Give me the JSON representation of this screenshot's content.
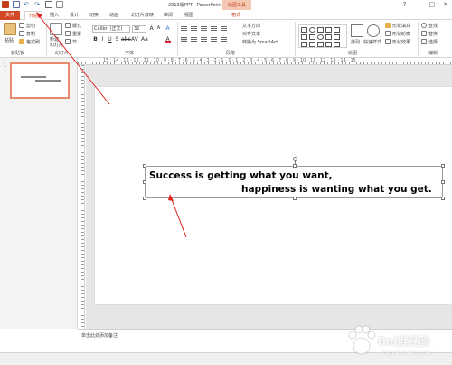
{
  "window": {
    "title": "2013版PPT - PowerPoint",
    "context_tab_group": "绘图工具",
    "controls": [
      "?",
      "—",
      "□",
      "✕"
    ]
  },
  "tabs": [
    {
      "label": "文件"
    },
    {
      "label": "开始"
    },
    {
      "label": "插入"
    },
    {
      "label": "设计"
    },
    {
      "label": "切换"
    },
    {
      "label": "动画"
    },
    {
      "label": "幻灯片放映"
    },
    {
      "label": "审阅"
    },
    {
      "label": "视图"
    },
    {
      "label": "格式"
    }
  ],
  "ribbon": {
    "clipboard": {
      "paste": "粘贴",
      "cut": "剪切",
      "copy": "复制",
      "format_painter": "格式刷",
      "group": "剪贴板"
    },
    "slides": {
      "new_slide": "新建\n幻灯片",
      "layout": "版式",
      "reset": "重置",
      "section": "节",
      "group": "幻灯片"
    },
    "font": {
      "font_name": "Calibri (正文)",
      "font_size": "32",
      "group": "字体"
    },
    "paragraph": {
      "text_direction": "文字方向",
      "align_text": "对齐文本",
      "smartart": "转换为 SmartArt",
      "group": "段落"
    },
    "drawing": {
      "arrange": "排列",
      "quick_styles": "快速样式",
      "shape_fill": "形状填充",
      "shape_outline": "形状轮廓",
      "shape_effects": "形状效果",
      "group": "绘图"
    },
    "editing": {
      "find": "查找",
      "replace": "替换",
      "select": "选择",
      "group": "编辑"
    }
  },
  "ruler": {
    "numbers": "15 · 14 · 13 · 12 · 11 · 10 · 9 · 8 · 7 · 6 · 5 · 4 · 3 · 2 · 1 · 0 · 1 · 2 · 3 · 4 · 5 · 6 · 7 · 8 · 9 · 10 · 11 · 12 · 13 · 14 · 15"
  },
  "thumbnails": [
    {
      "number": "1"
    }
  ],
  "slide": {
    "line1": "Success is getting what you want,",
    "line2": "happiness is wanting what you get."
  },
  "notes": {
    "placeholder": "单击此处添加备注"
  },
  "watermark": {
    "text": "Bai度经验",
    "url": "jingyan.baidu.com"
  },
  "colors": {
    "accent": "#d24726",
    "arrow": "#e0201b"
  }
}
